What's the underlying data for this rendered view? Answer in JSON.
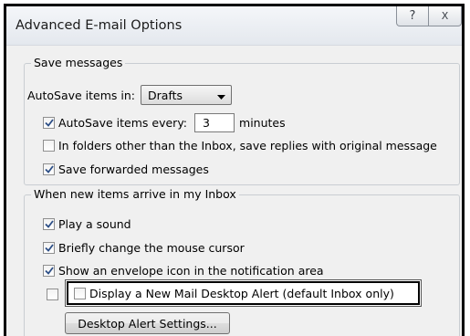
{
  "window": {
    "title": "Advanced E-mail Options",
    "help_glyph": "?",
    "close_glyph": "X"
  },
  "save_messages": {
    "legend": "Save messages",
    "autosave_in_label": "AutoSave items in:",
    "autosave_in_value": "Drafts",
    "autosave_every_label": "AutoSave items every:",
    "autosave_every_value": "3",
    "autosave_every_unit": "minutes",
    "autosave_every_checked": true,
    "replies_label": "In folders other than the Inbox, save replies with original message",
    "replies_checked": false,
    "forwarded_label": "Save forwarded messages",
    "forwarded_checked": true
  },
  "new_items": {
    "legend": "When new items arrive in my Inbox",
    "play_sound_label": "Play a sound",
    "play_sound_checked": true,
    "mouse_cursor_label": "Briefly change the mouse cursor",
    "mouse_cursor_checked": true,
    "envelope_label": "Show an envelope icon in the notification area",
    "envelope_checked": true,
    "desktop_alert_label": "Display a New Mail Desktop Alert (default Inbox only)",
    "desktop_alert_checked": false,
    "alert_settings_button": "Desktop Alert Settings..."
  }
}
